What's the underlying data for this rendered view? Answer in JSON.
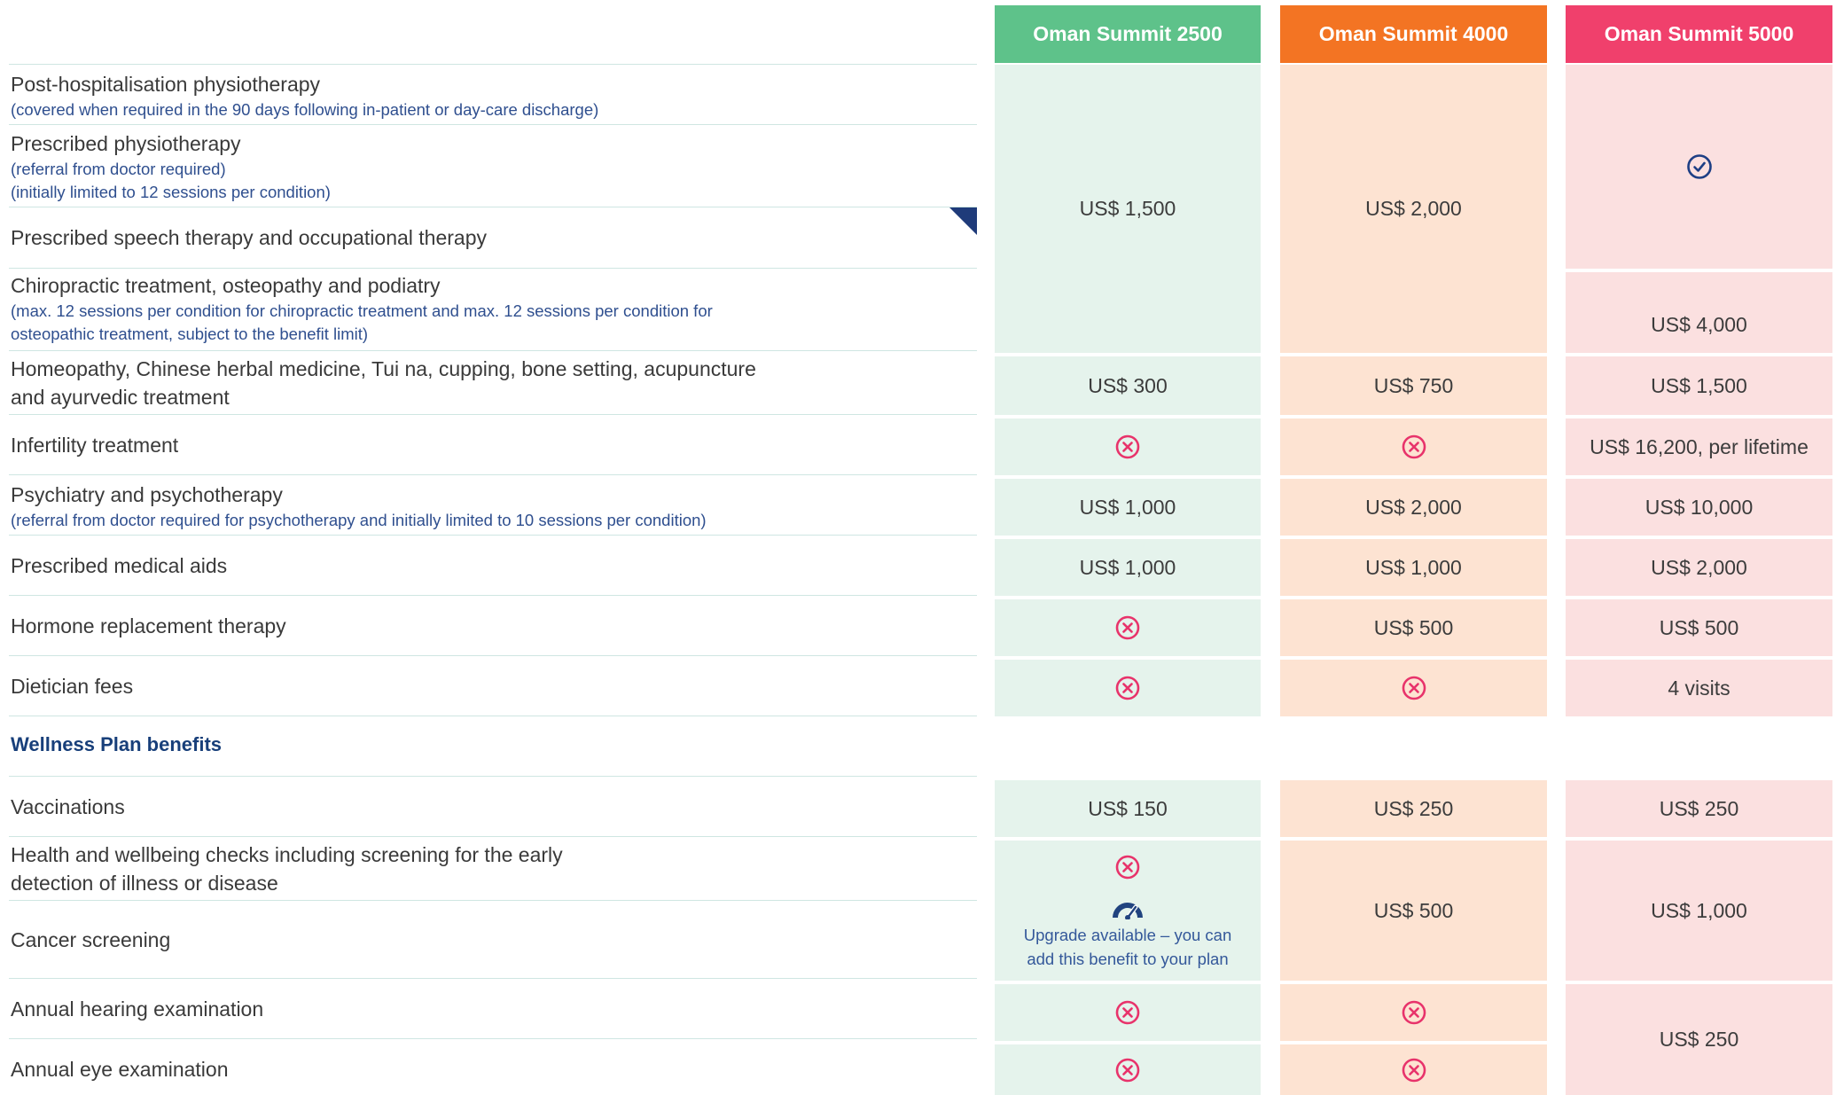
{
  "plans": [
    {
      "name": "Oman Summit 2500",
      "header_color": "#5ec28a",
      "cell_color": "#e5f3ec"
    },
    {
      "name": "Oman Summit 4000",
      "header_color": "#f37423",
      "cell_color": "#fde3d2"
    },
    {
      "name": "Oman Summit 5000",
      "header_color": "#f0406c",
      "cell_color": "#fbe0e0"
    }
  ],
  "rows": [
    {
      "label": "Post-hospitalisation physiotherapy",
      "notes": [
        "(covered when required in the 90 days following in-patient or day-care discharge)"
      ]
    },
    {
      "label": "Prescribed physiotherapy",
      "notes": [
        "(referral from doctor required)",
        "(initially limited to 12 sessions per condition)"
      ]
    },
    {
      "label": "Prescribed speech therapy and occupational therapy",
      "notes": []
    },
    {
      "label": "Chiropractic treatment, osteopathy and podiatry",
      "notes": [
        "(max. 12 sessions per condition for chiropractic treatment and max. 12 sessions per condition for",
        "osteopathic treatment, subject to the benefit limit)"
      ]
    },
    {
      "label_lines": [
        "Homeopathy, Chinese herbal medicine, Tui na, cupping, bone setting, acupuncture",
        "and ayurvedic treatment"
      ]
    },
    {
      "label": "Infertility treatment"
    },
    {
      "label": "Psychiatry and psychotherapy",
      "notes": [
        "(referral from doctor required for psychotherapy and initially limited to 10 sessions per condition)"
      ]
    },
    {
      "label": "Prescribed medical aids"
    },
    {
      "label": "Hormone replacement therapy"
    },
    {
      "label": "Dietician fees"
    }
  ],
  "section_title": "Wellness Plan benefits",
  "wellness_rows": [
    {
      "label": "Vaccinations"
    },
    {
      "label_lines": [
        "Health and wellbeing checks including screening for the early",
        "detection of illness or disease"
      ]
    },
    {
      "label": "Cancer screening"
    },
    {
      "label": "Annual hearing examination"
    },
    {
      "label": "Annual eye examination"
    }
  ],
  "values": {
    "therapy_2500": "US$ 1,500",
    "therapy_4000": "US$ 2,000",
    "chiro_5000": "US$ 4,000",
    "homeo": [
      "US$ 300",
      "US$ 750",
      "US$ 1,500"
    ],
    "infertility_5000": "US$ 16,200, per lifetime",
    "psych": [
      "US$ 1,000",
      "US$ 2,000",
      "US$ 10,000"
    ],
    "aids": [
      "US$ 1,000",
      "US$ 1,000",
      "US$ 2,000"
    ],
    "hrt": [
      "US$ 500",
      "US$ 500"
    ],
    "dietician_5000": "4 visits",
    "vaccinations": [
      "US$ 150",
      "US$ 250",
      "US$ 250"
    ],
    "health_checks_4000": "US$ 500",
    "health_checks_5000": "US$ 1,000",
    "hearing_eye_5000": "US$ 250"
  },
  "upgrade": {
    "line1": "Upgrade available – you can",
    "line2": "add this benefit to your plan"
  },
  "icons": {
    "covered": "check-circle-icon",
    "not_covered": "x-circle-icon",
    "upgrade": "gauge-icon"
  },
  "colors": {
    "cross": "#e8336b",
    "check": "#1e3f85",
    "accent_navy": "#183f7a"
  }
}
